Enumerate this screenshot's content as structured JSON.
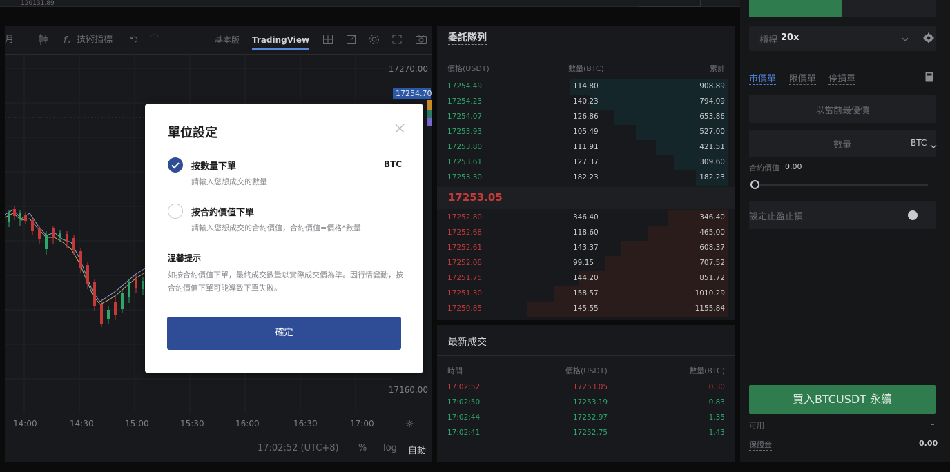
{
  "top": {
    "value": "120131.89"
  },
  "chart": {
    "toolbar": {
      "period_partial": "月",
      "indicators_label": "技術指標",
      "tab_basic": "基本版",
      "tab_tradingview": "TradingView"
    },
    "price_labels": [
      "17270.00",
      "17160.00"
    ],
    "last_price_tag": "17254.70",
    "time_labels": [
      "14:00",
      "14:30",
      "15:00",
      "15:30",
      "16:00",
      "16:30",
      "17:00"
    ],
    "footer": {
      "clock": "17:02:52 (UTC+8)",
      "percent": "%",
      "log": "log",
      "auto": "自動"
    }
  },
  "orderbook": {
    "title": "委託隊列",
    "headers": {
      "price": "價格(USDT)",
      "qty": "數量(BTC)",
      "total": "累計"
    },
    "asks": [
      {
        "price": "17254.49",
        "qty": "114.80",
        "total": "908.89",
        "depth": 0.79
      },
      {
        "price": "17254.23",
        "qty": "140.23",
        "total": "794.09",
        "depth": 0.69
      },
      {
        "price": "17254.07",
        "qty": "126.86",
        "total": "653.86",
        "depth": 0.57
      },
      {
        "price": "17253.93",
        "qty": "105.49",
        "total": "527.00",
        "depth": 0.46
      },
      {
        "price": "17253.80",
        "qty": "111.91",
        "total": "421.51",
        "depth": 0.36
      },
      {
        "price": "17253.61",
        "qty": "127.37",
        "total": "309.60",
        "depth": 0.27
      },
      {
        "price": "17253.30",
        "qty": "182.23",
        "total": "182.23",
        "depth": 0.16
      }
    ],
    "mid_price": "17253.05",
    "bids": [
      {
        "price": "17252.80",
        "qty": "346.40",
        "total": "346.40",
        "depth": 0.3
      },
      {
        "price": "17252.68",
        "qty": "118.60",
        "total": "465.00",
        "depth": 0.4
      },
      {
        "price": "17252.61",
        "qty": "143.37",
        "total": "608.37",
        "depth": 0.53
      },
      {
        "price": "17252.08",
        "qty": "99.15",
        "total": "707.52",
        "depth": 0.61
      },
      {
        "price": "17251.75",
        "qty": "144.20",
        "total": "851.72",
        "depth": 0.74
      },
      {
        "price": "17251.30",
        "qty": "158.57",
        "total": "1010.29",
        "depth": 0.87
      },
      {
        "price": "17250.85",
        "qty": "145.55",
        "total": "1155.84",
        "depth": 1.0
      }
    ]
  },
  "trades": {
    "title": "最新成交",
    "headers": {
      "time": "時間",
      "price": "價格(USDT)",
      "qty": "數量(BTC)"
    },
    "rows": [
      {
        "time": "17:02:52",
        "price": "17253.05",
        "qty": "0.30",
        "side": "sell"
      },
      {
        "time": "17:02:50",
        "price": "17253.19",
        "qty": "0.83",
        "side": "buy"
      },
      {
        "time": "17:02:44",
        "price": "17252.97",
        "qty": "1.35",
        "side": "buy"
      },
      {
        "time": "17:02:41",
        "price": "17252.75",
        "qty": "1.43",
        "side": "buy"
      }
    ]
  },
  "orderpanel": {
    "leverage_label": "槓桿",
    "leverage_value": "20x",
    "order_types": [
      "市價單",
      "限價單",
      "停損單"
    ],
    "market_price_placeholder": "以當前最優價",
    "quantity_placeholder": "數量",
    "quantity_unit": "BTC",
    "contract_value_label": "合約價值",
    "contract_value": "0.00",
    "tpsl_label": "設定止盈止損",
    "buy_button": "買入BTCUSDT 永續",
    "available_label": "可用",
    "available_value": "–",
    "margin_label": "保證金",
    "margin_value": "0.00"
  },
  "modal": {
    "title": "單位設定",
    "option_qty_label": "按數量下單",
    "option_qty_hint": "請輸入您想成交的數量",
    "option_qty_unit": "BTC",
    "option_value_label": "按合約價值下單",
    "option_value_hint": "請輸入您想成交的合約價值，合約價值=價格*數量",
    "tip_title": "溫馨提示",
    "tip_text": "如按合約價值下單，最終成交數量以實際成交價為準。因行情變動，按合約價值下單可能導致下單失敗。",
    "confirm_label": "確定"
  },
  "colors": {
    "accent_blue": "#2f4d97",
    "buy_green": "#2f7d4e",
    "ask_green": "#2ea86a",
    "bid_red": "#c43a3a"
  }
}
